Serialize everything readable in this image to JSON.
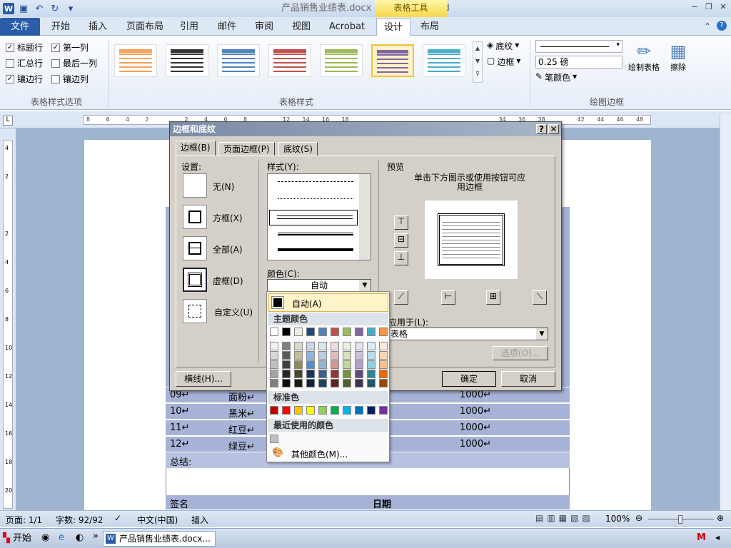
{
  "window": {
    "app_logo": "W",
    "title": "产品销售业绩表.docx - Microsoft Word",
    "context_group": "表格工具",
    "controls": {
      "minimize": "−",
      "restore": "❐",
      "close": "✕"
    }
  },
  "ribbon": {
    "file_tab": "文件",
    "tabs": [
      "开始",
      "插入",
      "页面布局",
      "引用",
      "邮件",
      "审阅",
      "视图",
      "Acrobat",
      "设计",
      "布局"
    ],
    "active_tab": "设计",
    "style_options": {
      "label": "表格样式选项",
      "items": [
        {
          "label": "标题行",
          "checked": true
        },
        {
          "label": "第一列",
          "checked": true
        },
        {
          "label": "汇总行",
          "checked": false
        },
        {
          "label": "最后一列",
          "checked": false
        },
        {
          "label": "镶边行",
          "checked": true
        },
        {
          "label": "镶边列",
          "checked": false
        }
      ]
    },
    "table_styles": {
      "label": "表格样式",
      "colors": [
        "#f7a35c",
        "#333333",
        "#4f81bd",
        "#c0504d",
        "#9bbb59",
        "#8064a2",
        "#4bacc6"
      ],
      "selected_index": 5
    },
    "shading_label": "底纹",
    "borders_label": "边框",
    "draw_borders": {
      "label": "绘图边框",
      "line_weight": "0.25 磅",
      "pen_color": "笔颜色",
      "draw_table": "绘制表格",
      "eraser": "擦除"
    }
  },
  "ruler": {
    "h_ticks": [
      "8",
      "6",
      "4",
      "2",
      "",
      "2",
      "4",
      "6",
      "8",
      "",
      "12",
      "14",
      "16",
      "18",
      "",
      "",
      "",
      "",
      "",
      "",
      "",
      "34",
      "36",
      "38",
      "",
      "42",
      "44",
      "46",
      "48"
    ],
    "v_ticks": [
      "4",
      "2",
      "",
      "2",
      "4",
      "6",
      "8",
      "10",
      "12",
      "14",
      "16",
      "18",
      "20"
    ]
  },
  "document": {
    "rows": [
      {
        "no": "09",
        "name": "面粉",
        "qty": "1000"
      },
      {
        "no": "10",
        "name": "黑米",
        "qty": "1000"
      },
      {
        "no": "11",
        "name": "红豆",
        "qty": "1000"
      },
      {
        "no": "12",
        "name": "绿豆",
        "qty": "1000"
      }
    ],
    "summary_label": "总结:",
    "sign_label": "签名",
    "date_label": "日期",
    "para_mark": "↵"
  },
  "dialog": {
    "title": "边框和底纹",
    "help": "?",
    "close": "✕",
    "tabs": [
      "边框(B)",
      "页面边框(P)",
      "底纹(S)"
    ],
    "settings_label": "设置:",
    "settings": [
      "无(N)",
      "方框(X)",
      "全部(A)",
      "虚框(D)",
      "自定义(U)"
    ],
    "style_label": "样式(Y):",
    "color_label": "颜色(C):",
    "color_value": "自动",
    "preview_label": "预览",
    "preview_hint": "单击下方图示或使用按钮可应用边框",
    "apply_to_label": "应用于(L):",
    "apply_to_value": "表格",
    "options_button": "选项(O)...",
    "horizontal_line_button": "横线(H)...",
    "ok_button": "确定",
    "cancel_button": "取消"
  },
  "color_popup": {
    "auto_label": "自动(A)",
    "theme_header": "主题颜色",
    "theme_top": [
      "#ffffff",
      "#000000",
      "#eeece1",
      "#1f497d",
      "#4f81bd",
      "#c0504d",
      "#9bbb59",
      "#8064a2",
      "#4bacc6",
      "#f79646"
    ],
    "theme_shades": [
      [
        "#f2f2f2",
        "#7f7f7f",
        "#ddd9c3",
        "#c6d9f0",
        "#dbe5f1",
        "#f2dcdb",
        "#ebf1dd",
        "#e5e0ec",
        "#dbeef3",
        "#fdeada"
      ],
      [
        "#d8d8d8",
        "#595959",
        "#c4bd97",
        "#8db3e2",
        "#b8cce4",
        "#e5b9b7",
        "#d7e3bc",
        "#ccc1d9",
        "#b7dde8",
        "#fbd5b5"
      ],
      [
        "#bfbfbf",
        "#3f3f3f",
        "#938953",
        "#548dd4",
        "#95b3d7",
        "#d99694",
        "#c3d69b",
        "#b2a2c7",
        "#92cddc",
        "#fac08f"
      ],
      [
        "#a5a5a5",
        "#262626",
        "#494429",
        "#17365d",
        "#366092",
        "#953734",
        "#76923c",
        "#5f497a",
        "#31859b",
        "#e36c09"
      ],
      [
        "#7f7f7f",
        "#0c0c0c",
        "#1d1b10",
        "#0f243e",
        "#244061",
        "#632423",
        "#4f6128",
        "#3f3151",
        "#205867",
        "#974806"
      ]
    ],
    "standard_header": "标准色",
    "standard": [
      "#c00000",
      "#ff0000",
      "#ffc000",
      "#ffff00",
      "#92d050",
      "#00b050",
      "#00b0f0",
      "#0070c0",
      "#002060",
      "#7030a0"
    ],
    "recent_header": "最近使用的颜色",
    "recent": [
      "#c0c0c0"
    ],
    "more_colors": "其他颜色(M)..."
  },
  "statusbar": {
    "page": "页面: 1/1",
    "words": "字数: 92/92",
    "language": "中文(中国)",
    "mode": "插入",
    "zoom": "100%"
  },
  "taskbar": {
    "start": "开始",
    "task": "产品销售业绩表.docx..."
  }
}
